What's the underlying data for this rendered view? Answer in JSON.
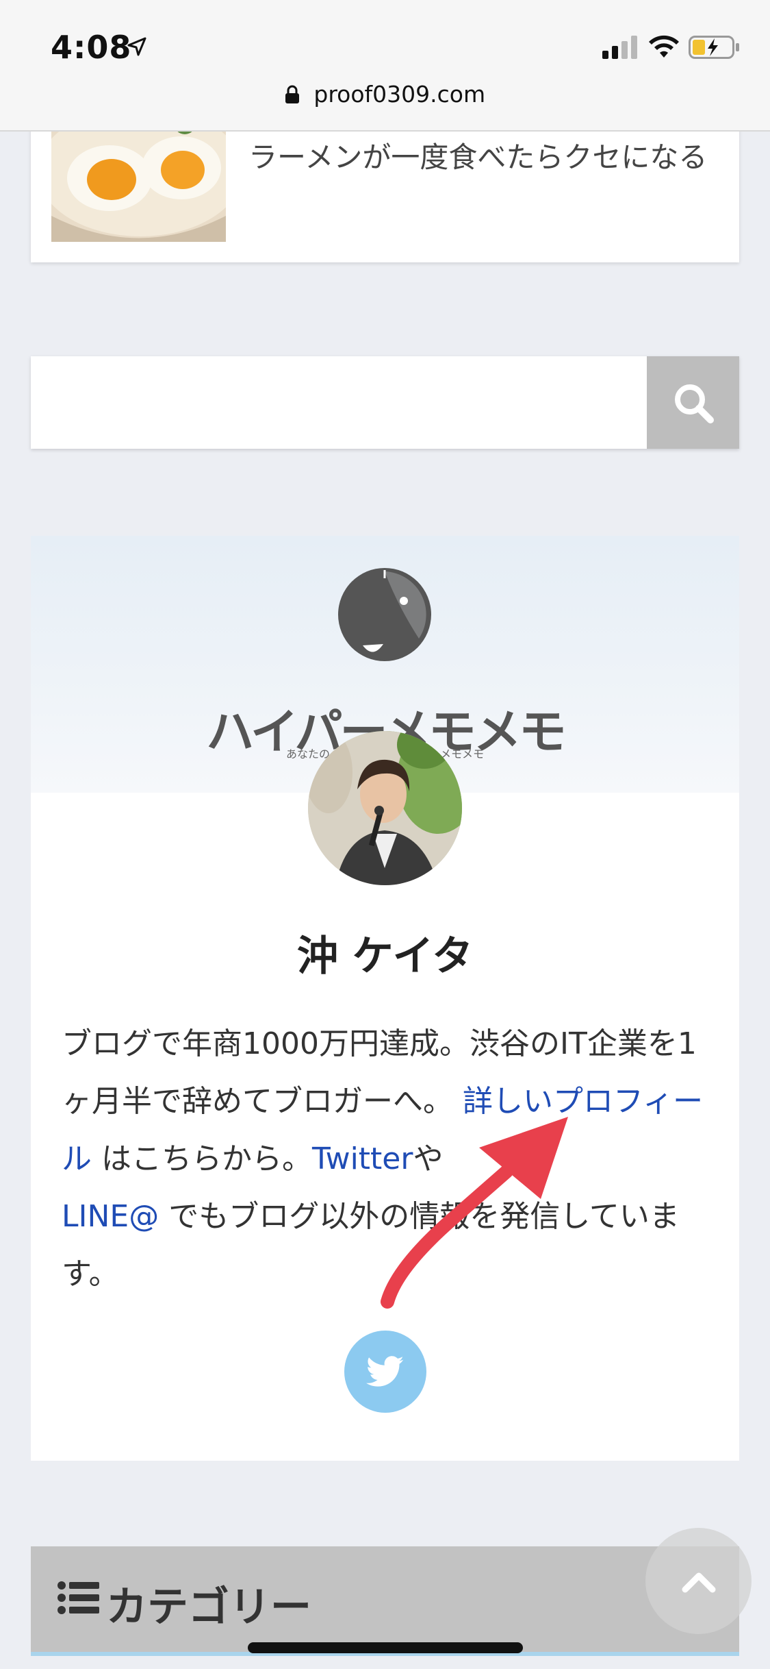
{
  "status_bar": {
    "time": "4:08",
    "icons": [
      "location-arrow-icon",
      "signal-icon",
      "wifi-icon",
      "battery-charging-icon"
    ]
  },
  "browser": {
    "url": "proof0309.com",
    "icon": "lock-icon"
  },
  "article_card": {
    "title": "ラーメンが一度食べたらクセになる"
  },
  "search": {
    "placeholder": "",
    "button_icon": "search-icon"
  },
  "profile": {
    "site_name": "ハイパーメモメモ",
    "tagline_left": "あなたの",
    "tagline_right": "メモメモ",
    "name": "沖 ケイタ",
    "bio_text_1": "ブログで年商1000万円達成。渋谷のIT企業を1ヶ月半で辞めてブロガーへ。",
    "bio_link_profile": "詳しいプロフィール",
    "bio_text_2": "はこちらから。",
    "bio_link_twitter": "Twitter",
    "bio_text_3": "や",
    "bio_link_line": "LINE@",
    "bio_text_4": " でもブログ以外の情報を発信しています。",
    "social_icon": "twitter-icon"
  },
  "categories": {
    "title": "カテゴリー",
    "icon": "list-icon"
  },
  "colors": {
    "background": "#eceef3",
    "link": "#1f4cb5",
    "twitter": "#8ccaf0",
    "annotation_arrow": "#e8404c",
    "category_header": "#c2c2c2"
  }
}
